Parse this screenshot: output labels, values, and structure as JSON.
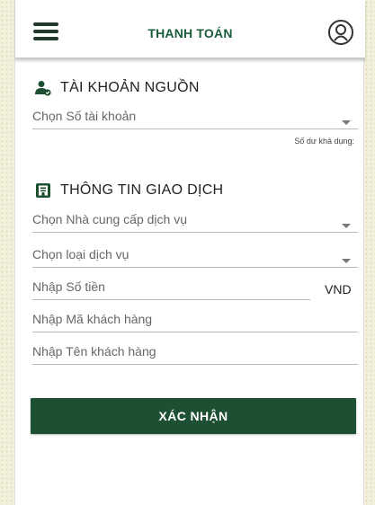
{
  "header": {
    "title": "THANH TOÁN",
    "menu_icon": "hamburger-menu-icon",
    "profile_icon": "user-avatar-icon"
  },
  "source_account": {
    "heading": "TÀI KHOẢN NGUỒN",
    "icon": "user-account-icon",
    "account_select_placeholder": "Chọn Số tài khoản",
    "balance_label": "Số dư khả dụng:"
  },
  "transaction": {
    "heading": "THÔNG TIN GIAO DỊCH",
    "icon": "document-icon",
    "provider_select_placeholder": "Chọn Nhà cung cấp dịch vụ",
    "service_type_select_placeholder": "Chọn loại dịch vụ",
    "amount_placeholder": "Nhập Số tiền",
    "amount_unit": "VND",
    "customer_code_placeholder": "Nhập Mã khách hàng",
    "customer_name_placeholder": "Nhập Tên khách hàng"
  },
  "actions": {
    "confirm_label": "XÁC NHẬN"
  },
  "colors": {
    "brand_green": "#1d4f33",
    "title_green": "#1a5d3a"
  }
}
